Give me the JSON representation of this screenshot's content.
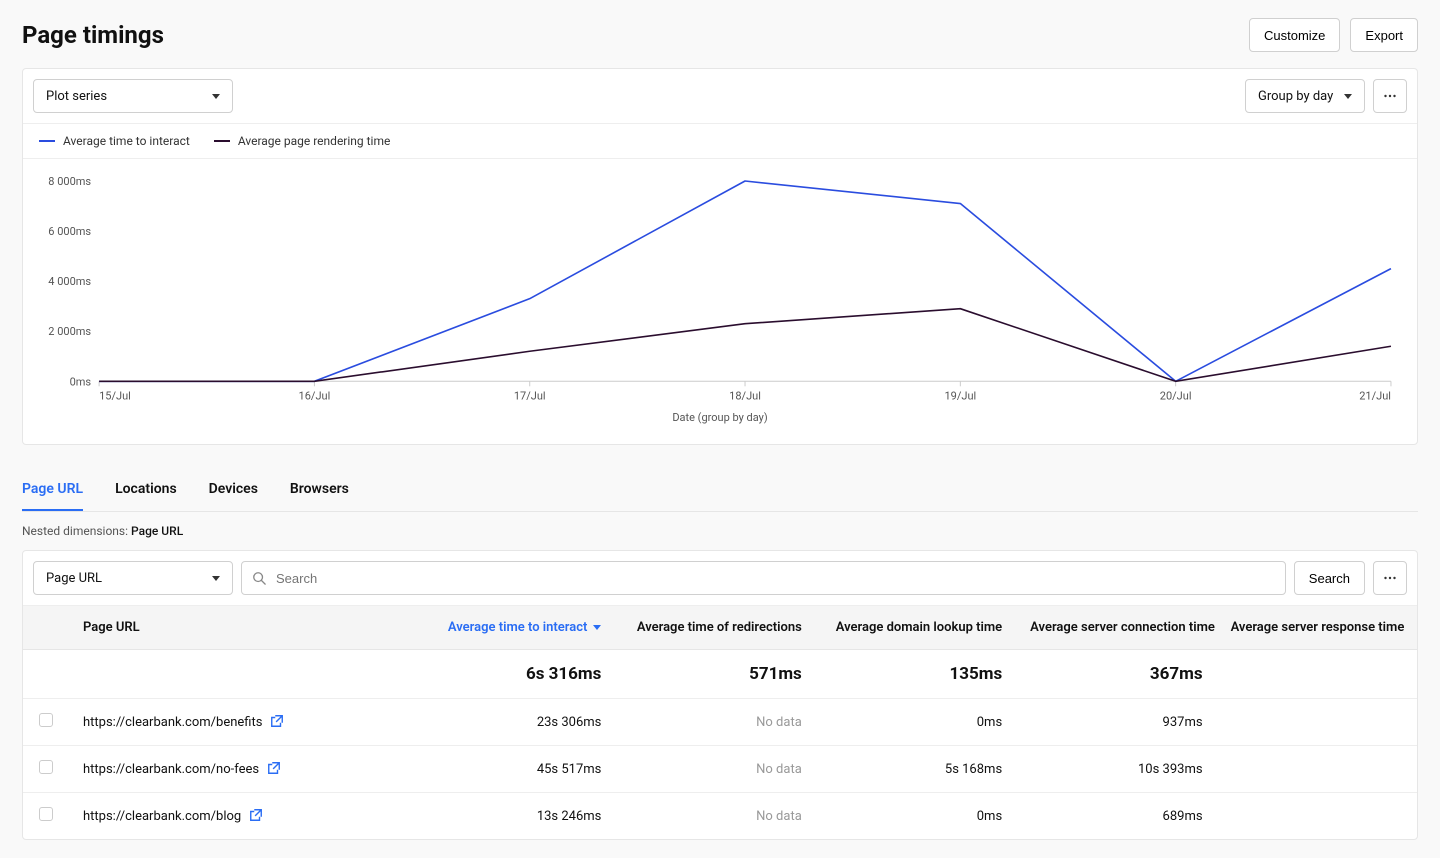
{
  "page_title": "Page timings",
  "header": {
    "customize_label": "Customize",
    "export_label": "Export"
  },
  "chart_card": {
    "plot_series_label": "Plot series",
    "group_by_label": "Group by day",
    "legend": {
      "series_a": "Average time to interact",
      "series_b": "Average page rendering time"
    },
    "series_a_color": "#2a4cdf",
    "series_b_color": "#2a0d2e"
  },
  "chart_data": {
    "type": "line",
    "title": "",
    "xlabel": "Date (group by day)",
    "ylabel": "",
    "ylim": [
      0,
      8000
    ],
    "y_ticks": [
      "0ms",
      "2 000ms",
      "4 000ms",
      "6 000ms",
      "8 000ms"
    ],
    "categories": [
      "15/Jul",
      "16/Jul",
      "17/Jul",
      "18/Jul",
      "19/Jul",
      "20/Jul",
      "21/Jul"
    ],
    "series": [
      {
        "name": "Average time to interact",
        "color": "#2a4cdf",
        "values": [
          0,
          0,
          3300,
          8000,
          7100,
          0,
          4500
        ]
      },
      {
        "name": "Average page rendering time",
        "color": "#2a0d2e",
        "values": [
          0,
          0,
          1200,
          2300,
          2900,
          0,
          1400
        ]
      }
    ]
  },
  "tabs": {
    "items": [
      "Page URL",
      "Locations",
      "Devices",
      "Browsers"
    ],
    "active_index": 0
  },
  "nested_dimensions": {
    "label": "Nested dimensions: ",
    "value": "Page URL"
  },
  "table": {
    "dimension_label": "Page URL",
    "search_placeholder": "Search",
    "search_button_label": "Search",
    "columns": [
      "Page URL",
      "Average time to interact",
      "Average time of redirections",
      "Average domain lookup time",
      "Average server connection time",
      "Average server response time"
    ],
    "sorted_column_index": 1,
    "summary": {
      "avg_time_to_interact": "6s 316ms",
      "avg_redirections": "571ms",
      "avg_domain_lookup": "135ms",
      "avg_server_connection": "367ms"
    },
    "no_data_text": "No data",
    "rows": [
      {
        "url": "https://clearbank.com/benefits",
        "avg_time_to_interact": "23s 306ms",
        "avg_redirections": null,
        "avg_domain_lookup": "0ms",
        "avg_server_connection": "937ms"
      },
      {
        "url": "https://clearbank.com/no-fees",
        "avg_time_to_interact": "45s 517ms",
        "avg_redirections": null,
        "avg_domain_lookup": "5s 168ms",
        "avg_server_connection": "10s 393ms"
      },
      {
        "url": "https://clearbank.com/blog",
        "avg_time_to_interact": "13s 246ms",
        "avg_redirections": null,
        "avg_domain_lookup": "0ms",
        "avg_server_connection": "689ms"
      }
    ]
  }
}
